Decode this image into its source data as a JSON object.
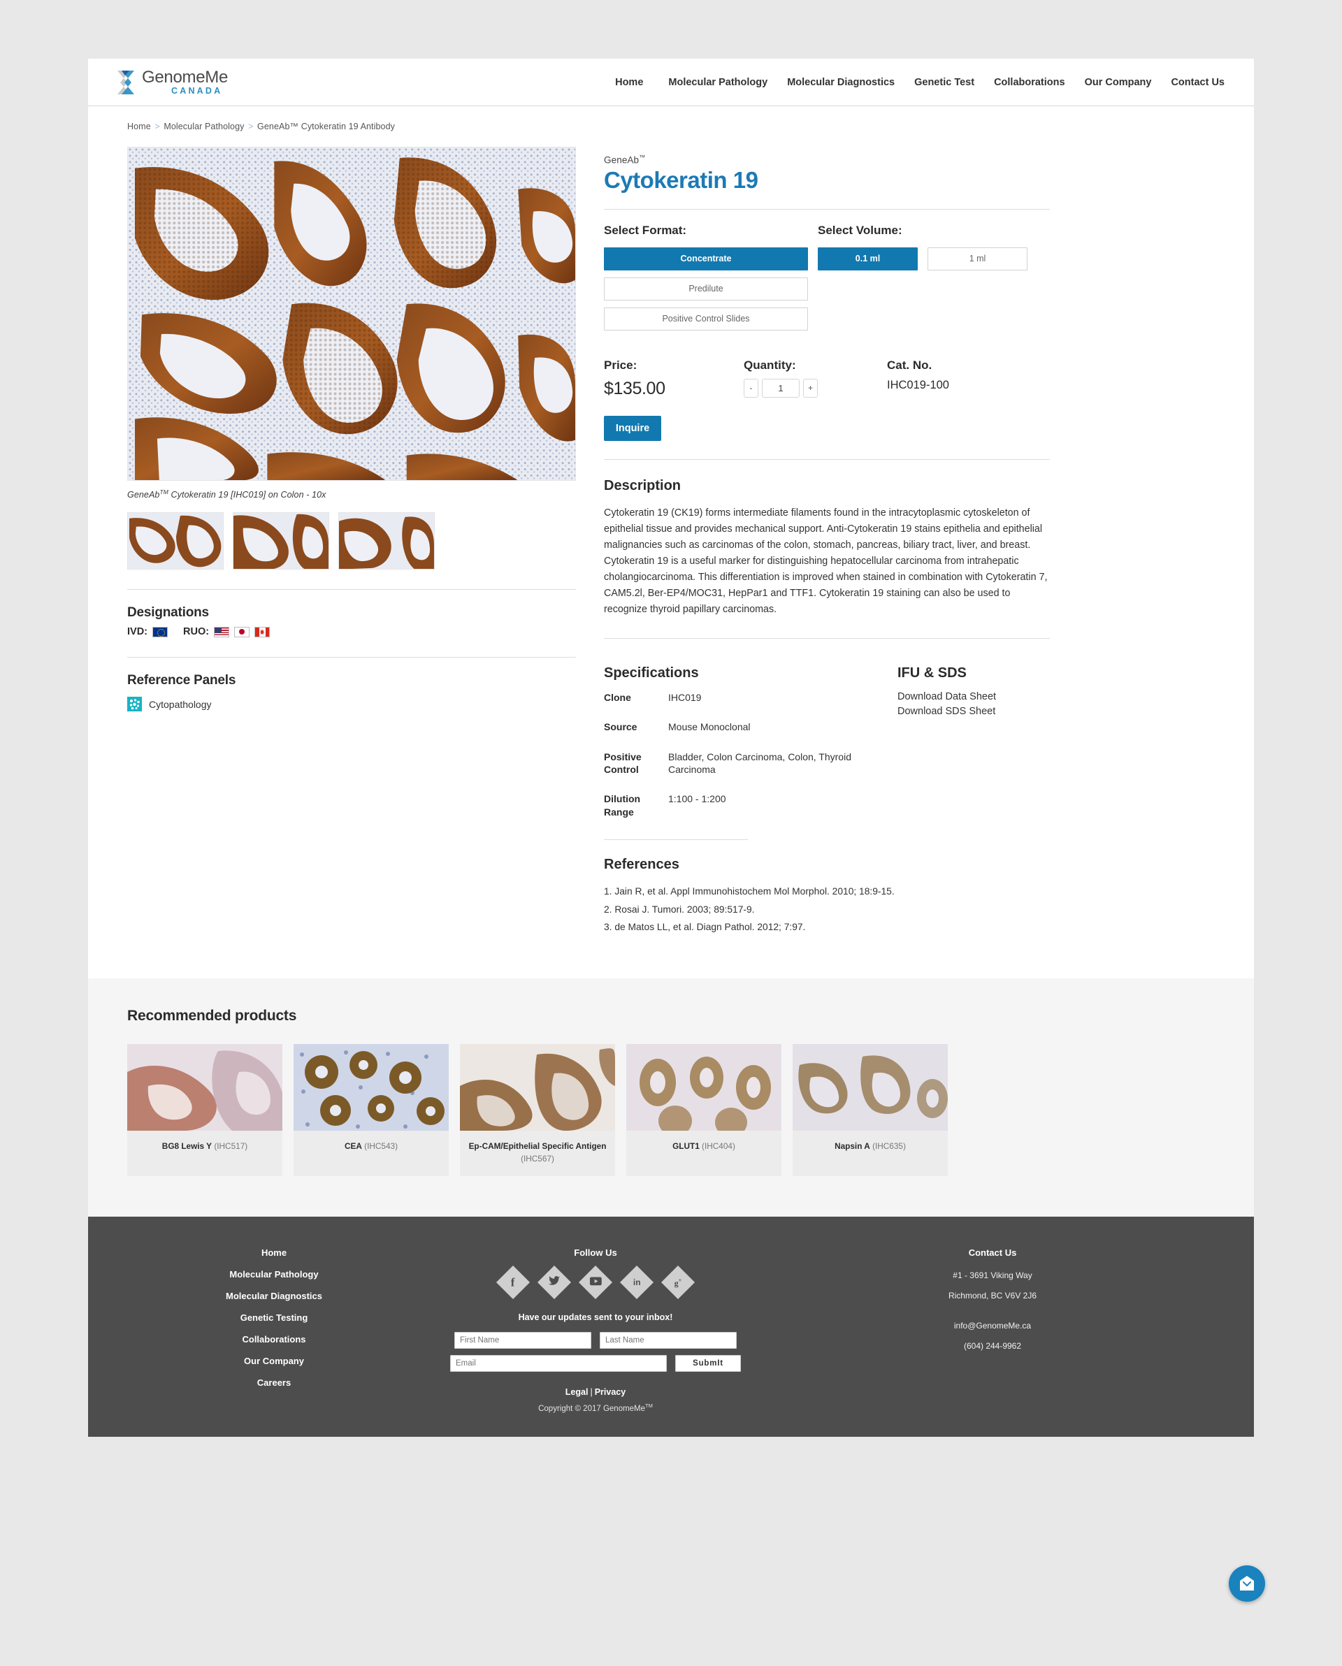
{
  "header": {
    "logo_name": "GenomeMe",
    "logo_sub": "CANADA",
    "nav": [
      {
        "label": "Home"
      },
      {
        "label": "Molecular Pathology"
      },
      {
        "label": "Molecular Diagnostics"
      },
      {
        "label": "Genetic Test"
      },
      {
        "label": "Collaborations"
      },
      {
        "label": "Our Company"
      },
      {
        "label": "Contact Us"
      }
    ]
  },
  "breadcrumb": {
    "items": [
      "Home",
      "Molecular Pathology",
      "GeneAb™ Cytokeratin 19 Antibody"
    ],
    "separator": ">"
  },
  "product": {
    "brand": "GeneAb",
    "brand_tm": "™",
    "name": "Cytokeratin 19",
    "image_caption_pre": "GeneAb",
    "image_caption_tm": "TM",
    "image_caption_post": " Cytokeratin 19 [IHC019] on Colon - 10x",
    "format_label": "Select Format:",
    "volume_label": "Select Volume:",
    "formats": [
      {
        "label": "Concentrate",
        "selected": true
      },
      {
        "label": "Predilute",
        "selected": false
      },
      {
        "label": "Positive Control Slides",
        "selected": false
      }
    ],
    "volumes": [
      {
        "label": "0.1 ml",
        "selected": true
      },
      {
        "label": "1 ml",
        "selected": false
      }
    ],
    "price_label": "Price:",
    "price_value": "$135.00",
    "quantity_label": "Quantity:",
    "quantity_value": "1",
    "qty_minus": "-",
    "qty_plus": "+",
    "cat_label": "Cat. No.",
    "cat_value": "IHC019-100",
    "inquire_label": "Inquire"
  },
  "description": {
    "title": "Description",
    "body": "Cytokeratin 19 (CK19) forms intermediate filaments found in the intracytoplasmic cytoskeleton of epithelial tissue and provides mechanical support. Anti-Cytokeratin 19 stains epithelia and epithelial malignancies such as carcinomas of the colon, stomach, pancreas, biliary tract, liver, and breast. Cytokeratin 19 is a useful marker for distinguishing hepatocellular carcinoma from intrahepatic cholangiocarcinoma. This differentiation is improved when stained in combination with Cytokeratin 7, CAM5.2l, Ber-EP4/MOC31, HepPar1 and TTF1. Cytokeratin 19 staining can also be used to recognize thyroid papillary carcinomas."
  },
  "specifications": {
    "title": "Specifications",
    "rows": [
      {
        "key": "Clone",
        "value": "IHC019"
      },
      {
        "key": "Source",
        "value": "Mouse Monoclonal"
      },
      {
        "key": "Positive Control",
        "value": "Bladder, Colon Carcinoma, Colon, Thyroid Carcinoma"
      },
      {
        "key": "Dilution Range",
        "value": "1:100 - 1:200"
      }
    ]
  },
  "ifu_sds": {
    "title": "IFU & SDS",
    "links": [
      {
        "label": "Download Data Sheet"
      },
      {
        "label": "Download SDS Sheet"
      }
    ]
  },
  "references": {
    "title": "References",
    "items": [
      "1. Jain R, et al. Appl Immunohistochem Mol Morphol. 2010; 18:9-15.",
      "2. Rosai J. Tumori. 2003; 89:517-9.",
      "3. de Matos LL, et al. Diagn Pathol. 2012; 7:97."
    ]
  },
  "designations": {
    "title": "Designations",
    "ivd_label": "IVD:",
    "ivd_flags": [
      "eu"
    ],
    "ruo_label": "RUO:",
    "ruo_flags": [
      "us",
      "jp",
      "ca"
    ]
  },
  "reference_panels": {
    "title": "Reference Panels",
    "items": [
      {
        "label": "Cytopathology"
      }
    ]
  },
  "recommended": {
    "title": "Recommended products",
    "items": [
      {
        "name": "BG8 Lewis Y",
        "code": "(IHC517)"
      },
      {
        "name": "CEA",
        "code": "(IHC543)"
      },
      {
        "name": "Ep-CAM/Epithelial Specific Antigen",
        "code": "(IHC567)"
      },
      {
        "name": "GLUT1",
        "code": "(IHC404)"
      },
      {
        "name": "Napsin A",
        "code": "(IHC635)"
      }
    ]
  },
  "footer": {
    "nav": [
      {
        "label": "Home"
      },
      {
        "label": "Molecular Pathology"
      },
      {
        "label": "Molecular Diagnostics"
      },
      {
        "label": "Genetic Testing"
      },
      {
        "label": "Collaborations"
      },
      {
        "label": "Our Company"
      },
      {
        "label": "Careers"
      }
    ],
    "follow_title": "Follow Us",
    "social": [
      {
        "name": "facebook",
        "glyph": "f"
      },
      {
        "name": "twitter",
        "glyph": "🐦"
      },
      {
        "name": "youtube",
        "glyph": "▶"
      },
      {
        "name": "linkedin",
        "glyph": "in"
      },
      {
        "name": "googleplus",
        "glyph": "g+"
      }
    ],
    "newsletter_title": "Have our updates sent to your inbox!",
    "first_name_placeholder": "First Name",
    "last_name_placeholder": "Last Name",
    "email_placeholder": "Email",
    "submit_label": "SubmIt",
    "legal_label": "Legal",
    "legal_sep": "|",
    "privacy_label": "Privacy",
    "copyright_pre": "Copyright © 2017 GenomeMe",
    "copyright_tm": "TM",
    "contact_title": "Contact Us",
    "address_line1": "#1 - 3691 Viking Way",
    "address_line2": "Richmond, BC V6V 2J6",
    "email": "info@GenomeMe.ca",
    "phone": "(604) 244-9962"
  },
  "chat": {
    "icon": "envelope-icon"
  },
  "colors": {
    "accent": "#1279b0",
    "title_blue": "#1b7ab5",
    "footer_bg": "#4d4d4d",
    "panel_teal": "#17b4c4",
    "page_bg": "#e8e8e8"
  }
}
